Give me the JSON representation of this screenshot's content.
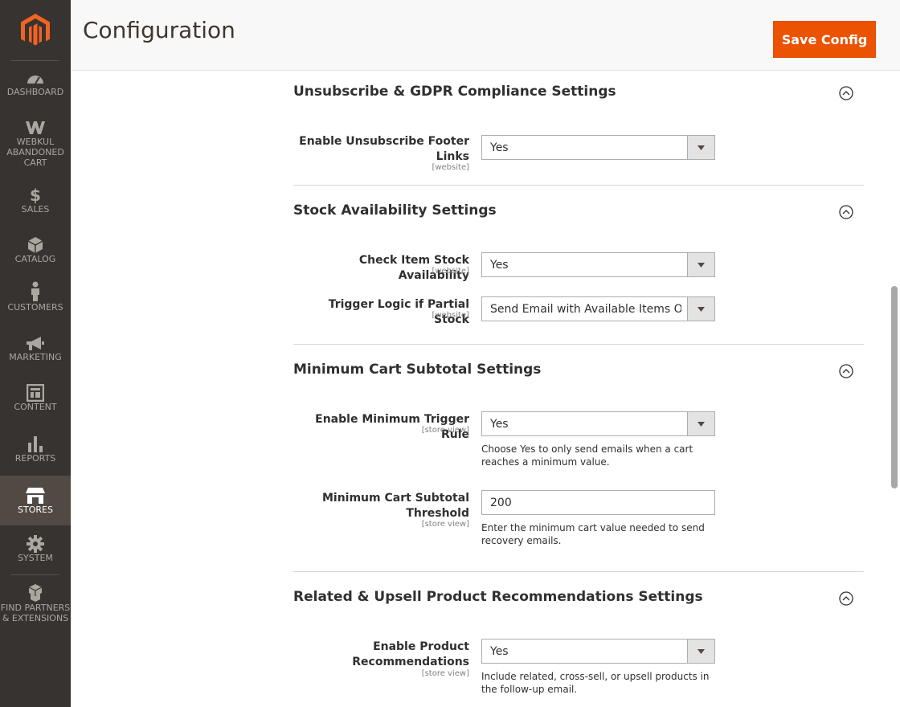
{
  "sidebar": {
    "logo": "magento-logo",
    "items": [
      {
        "label": "DASHBOARD",
        "icon": "dashboard-icon"
      },
      {
        "label": "WEBKUL ABANDONED CART",
        "icon": "webkul-icon"
      },
      {
        "label": "SALES",
        "icon": "dollar-icon"
      },
      {
        "label": "CATALOG",
        "icon": "box-icon"
      },
      {
        "label": "CUSTOMERS",
        "icon": "person-icon"
      },
      {
        "label": "MARKETING",
        "icon": "megaphone-icon"
      },
      {
        "label": "CONTENT",
        "icon": "layout-icon"
      },
      {
        "label": "REPORTS",
        "icon": "bar-chart-icon"
      },
      {
        "label": "STORES",
        "icon": "store-icon",
        "active": true
      },
      {
        "label": "SYSTEM",
        "icon": "gear-icon"
      },
      {
        "label": "FIND PARTNERS & EXTENSIONS",
        "icon": "cubes-icon"
      }
    ]
  },
  "header": {
    "title": "Configuration",
    "save_label": "Save Config"
  },
  "sections": [
    {
      "title": "Unsubscribe & GDPR Compliance Settings",
      "fields": [
        {
          "label": "Enable Unsubscribe Footer Links",
          "scope": "[website]",
          "value": "Yes"
        }
      ]
    },
    {
      "title": "Stock Availability Settings",
      "fields": [
        {
          "label": "Check Item Stock Availability",
          "scope": "[website]",
          "value": "Yes"
        },
        {
          "label": "Trigger Logic if Partial Stock",
          "scope": "[website]",
          "value": "Send Email with Available Items Only"
        }
      ]
    },
    {
      "title": "Minimum Cart Subtotal Settings",
      "fields": [
        {
          "label": "Enable Minimum Trigger Rule",
          "scope": "[store view]",
          "value": "Yes",
          "note": "Choose Yes to only send emails when a cart reaches a minimum value."
        },
        {
          "label": "Minimum Cart Subtotal Threshold",
          "scope": "[store view]",
          "value": "200",
          "note": "Enter the minimum cart value needed to send recovery emails."
        }
      ]
    },
    {
      "title": "Related & Upsell Product Recommendations Settings",
      "fields": [
        {
          "label": "Enable Product Recommendations",
          "scope": "[store view]",
          "value": "Yes",
          "note": "Include related, cross-sell, or upsell products in the follow-up email."
        }
      ]
    }
  ],
  "colors": {
    "sidebar_bg": "#373330",
    "accent": "#eb5202",
    "active_nav": "#514943"
  }
}
